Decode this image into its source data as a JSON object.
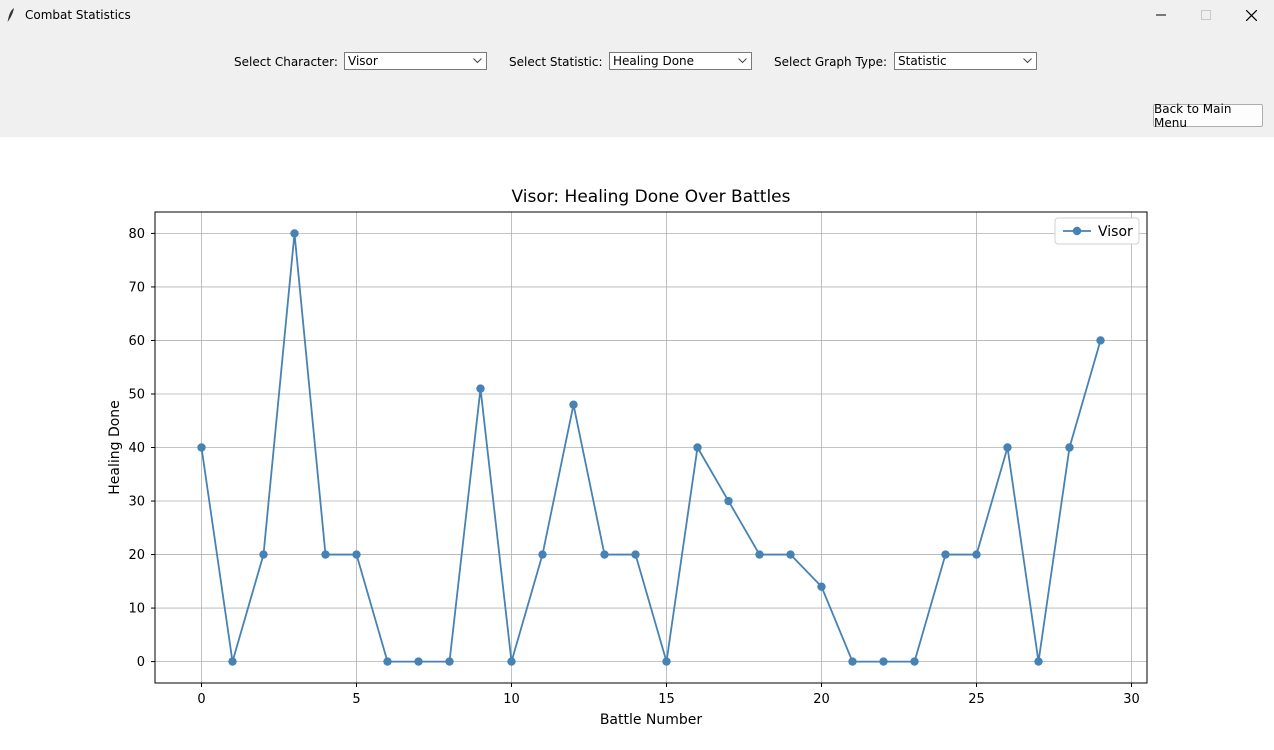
{
  "window": {
    "title": "Combat Statistics"
  },
  "controls": {
    "character_label": "Select Character:",
    "character_value": "Visor",
    "statistic_label": "Select Statistic:",
    "statistic_value": "Healing Done",
    "graph_type_label": "Select Graph Type:",
    "graph_type_value": "Statistic",
    "back_button": "Back to Main Menu"
  },
  "chart_data": {
    "type": "line",
    "title": "Visor: Healing Done Over Battles",
    "xlabel": "Battle Number",
    "ylabel": "Healing Done",
    "xlim": [
      -1.5,
      30.5
    ],
    "ylim": [
      -4,
      84
    ],
    "xticks": [
      0,
      5,
      10,
      15,
      20,
      25,
      30
    ],
    "yticks": [
      0,
      10,
      20,
      30,
      40,
      50,
      60,
      70,
      80
    ],
    "grid": true,
    "legend_position": "top-right",
    "series": [
      {
        "name": "Visor",
        "color": "#4682b4",
        "marker": "circle",
        "x": [
          0,
          1,
          2,
          3,
          4,
          5,
          6,
          7,
          8,
          9,
          10,
          11,
          12,
          13,
          14,
          15,
          16,
          17,
          18,
          19,
          20,
          21,
          22,
          23,
          24,
          25,
          26,
          27,
          28,
          29
        ],
        "y": [
          40,
          0,
          20,
          80,
          20,
          20,
          0,
          0,
          0,
          51,
          0,
          20,
          48,
          20,
          20,
          0,
          40,
          30,
          20,
          20,
          14,
          0,
          0,
          0,
          20,
          20,
          40,
          0,
          40,
          60
        ]
      }
    ]
  }
}
